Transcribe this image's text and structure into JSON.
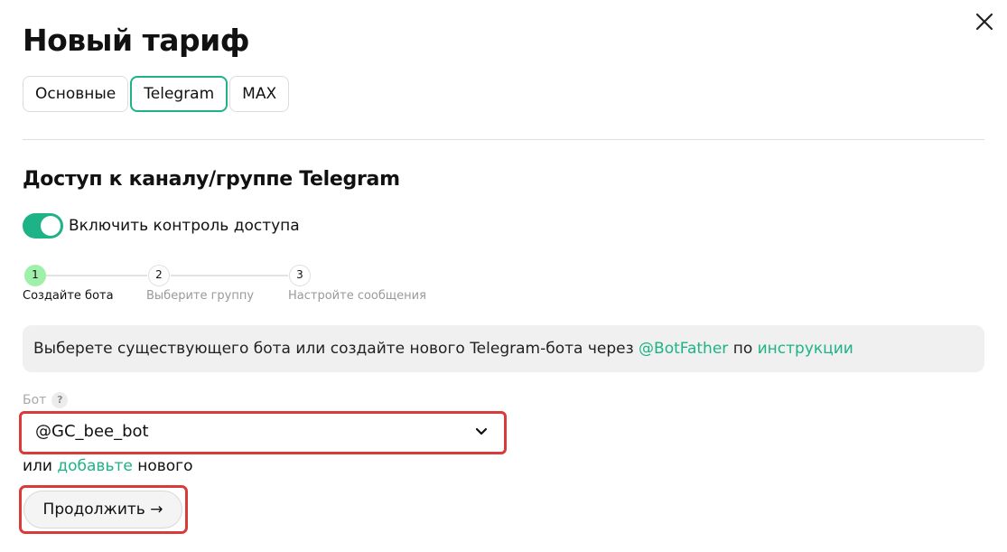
{
  "header": {
    "title": "Новый тариф"
  },
  "tabs": [
    {
      "label": "Основные",
      "active": false
    },
    {
      "label": "Telegram",
      "active": true
    },
    {
      "label": "MAX",
      "active": false
    }
  ],
  "section": {
    "title": "Доступ к каналу/группе Telegram"
  },
  "toggle": {
    "label": "Включить контроль доступа",
    "on": true
  },
  "stepper": {
    "steps": [
      {
        "number": "1",
        "label": "Создайте бота",
        "active": true
      },
      {
        "number": "2",
        "label": "Выберите группу",
        "active": false
      },
      {
        "number": "3",
        "label": "Настройте сообщения",
        "active": false
      }
    ]
  },
  "info": {
    "text": "Выберете существующего бота или создайте нового Telegram-бота через ",
    "link_botfather": "@BotFather",
    "middle": " по ",
    "link_instructions": "инструкции"
  },
  "bot_field": {
    "label": "Бот",
    "help": "?",
    "value": "@GC_bee_bot"
  },
  "add_bot": {
    "prefix": "или ",
    "link": "добавьте",
    "suffix": " нового"
  },
  "continue_button": {
    "label": "Продолжить →"
  },
  "colors": {
    "accent": "#1eb386",
    "step_active": "#9ff0a8",
    "highlight": "#d93a3a"
  }
}
